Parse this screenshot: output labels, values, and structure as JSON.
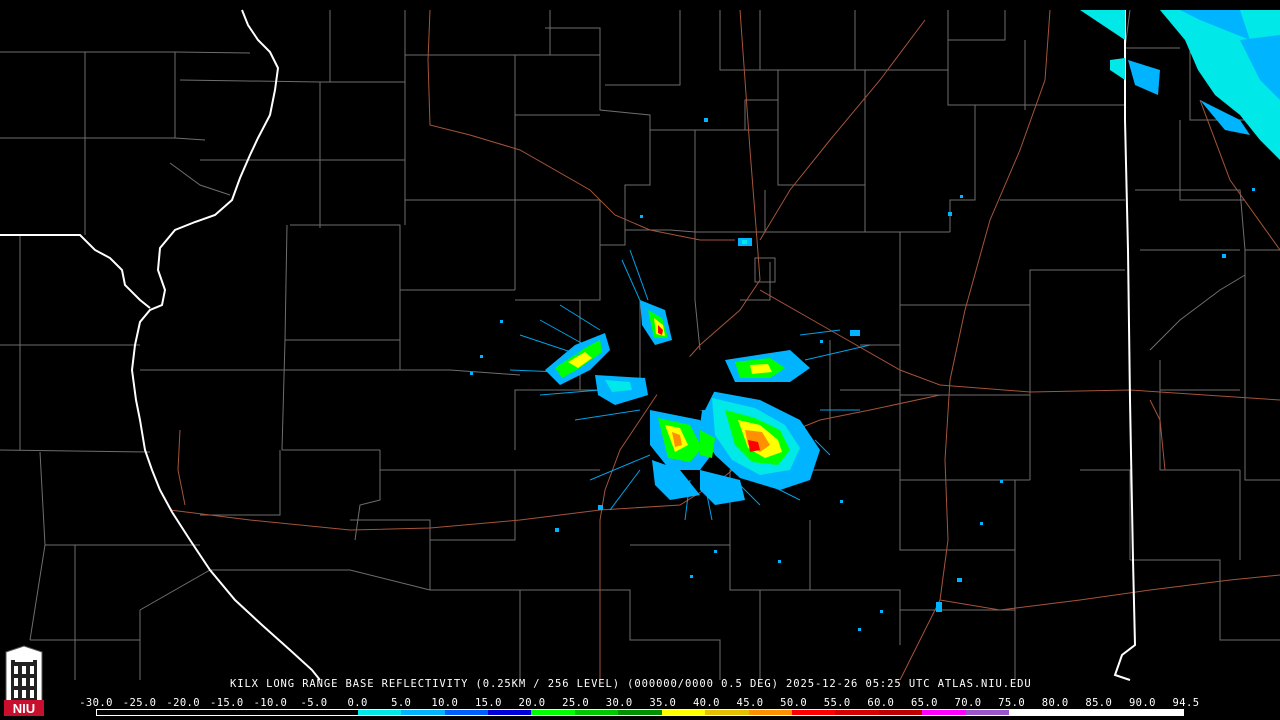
{
  "caption": {
    "text": "KILX LONG RANGE BASE REFLECTIVITY (0.25KM / 256 LEVEL) (000000/0000 0.5 DEG) 2025-12-26 05:25 UTC  ATLAS.NIU.EDU"
  },
  "scale": {
    "labels": [
      "-30.0",
      "-25.0",
      "-20.0",
      "-15.0",
      "-10.0",
      "-5.0",
      "0.0",
      "5.0",
      "10.0",
      "15.0",
      "20.0",
      "25.0",
      "30.0",
      "35.0",
      "40.0",
      "45.0",
      "50.0",
      "55.0",
      "60.0",
      "65.0",
      "70.0",
      "75.0",
      "80.0",
      "85.0",
      "90.0",
      "94.5"
    ],
    "colors": [
      "#000000",
      "#000000",
      "#000000",
      "#000000",
      "#000000",
      "#000000",
      "#00e8e8",
      "#00b4ff",
      "#0060ff",
      "#0000d8",
      "#00ff00",
      "#00c800",
      "#009000",
      "#ffff00",
      "#e7c000",
      "#ff9000",
      "#ff0000",
      "#d60000",
      "#c00000",
      "#ff00ff",
      "#9955c9",
      "#ffffff",
      "#ffffff",
      "#ffffff",
      "#ffffff"
    ]
  },
  "logo": {
    "text": "NIU"
  },
  "colors": {
    "background": "#000000",
    "county_lines": "#6e6e6e",
    "state_lines": "#ffffff",
    "roads": "#a5543a"
  }
}
